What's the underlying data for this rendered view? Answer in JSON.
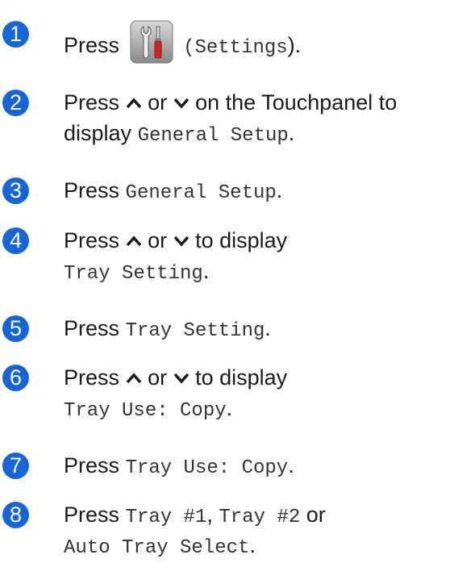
{
  "steps": [
    {
      "number": "1",
      "press": "Press",
      "paren_open": "(",
      "settings": "Settings",
      "paren_close": ").",
      "icon": "settings-icon"
    },
    {
      "number": "2",
      "press": "Press",
      "or": "or",
      "on_text": "on the Touchpanel to",
      "display": "display",
      "value": "General Setup",
      "period": "."
    },
    {
      "number": "3",
      "press": "Press",
      "value": "General Setup",
      "period": "."
    },
    {
      "number": "4",
      "press": "Press",
      "or": "or",
      "to_display": "to display",
      "value": "Tray Setting",
      "period": "."
    },
    {
      "number": "5",
      "press": "Press",
      "value": "Tray Setting",
      "period": "."
    },
    {
      "number": "6",
      "press": "Press",
      "or": "or",
      "to_display": "to display",
      "value": "Tray Use: Copy",
      "period": "."
    },
    {
      "number": "7",
      "press": "Press",
      "value": "Tray Use: Copy",
      "period": "."
    },
    {
      "number": "8",
      "press": "Press",
      "opt1": "Tray #1",
      "comma": ",",
      "opt2": "Tray #2",
      "or": "or",
      "opt3": "Auto Tray Select",
      "period": "."
    }
  ],
  "colors": {
    "step_badge": "#1565d8",
    "text": "#1a1a1a"
  },
  "icons": {
    "up": "chevron-up-icon",
    "down": "chevron-down-icon"
  }
}
